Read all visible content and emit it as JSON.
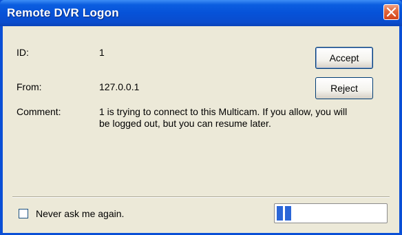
{
  "window": {
    "title": "Remote DVR Logon"
  },
  "fields": {
    "id_label": "ID:",
    "id_value": "1",
    "from_label": "From:",
    "from_value": "127.0.0.1",
    "comment_label": "Comment:",
    "comment_line1": "1 is trying to connect to this Multicam. If you allow, you will",
    "comment_line2": "be logged out, but you can resume later."
  },
  "buttons": {
    "accept_label": "Accept",
    "reject_label": "Reject"
  },
  "options": {
    "never_ask_label": "Never ask me again.",
    "never_ask_checked": false
  },
  "progress": {
    "blocks_filled": 2
  },
  "colors": {
    "titlebar": "#0652d8",
    "close_button": "#d4451b",
    "dialog_background": "#ece9d8",
    "progress_fill": "#2b66d7"
  },
  "icons": {
    "close": "close-icon"
  }
}
